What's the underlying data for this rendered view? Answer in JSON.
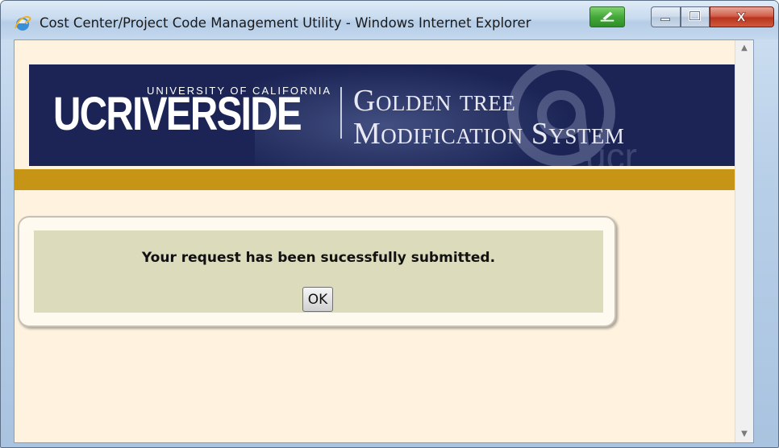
{
  "window": {
    "title": "Cost Center/Project Code Management Utility - Windows Internet Explorer",
    "icon": "internet-explorer-icon",
    "controls": [
      "minimize-icon",
      "maximize-icon",
      "close-icon"
    ],
    "close_label": "X"
  },
  "banner": {
    "university_small": "UNIVERSITY OF CALIFORNIA",
    "university_logo": "UCRIVERSIDE",
    "system_line1": "Golden tree",
    "system_line2": "Modification System",
    "colors": {
      "navy": "#1b2455",
      "gold": "#c79516"
    }
  },
  "dialog": {
    "message": "Your request has been sucessfully submitted.",
    "ok_label": "OK"
  },
  "scrollbar": {
    "up_glyph": "▲",
    "down_glyph": "▼"
  }
}
